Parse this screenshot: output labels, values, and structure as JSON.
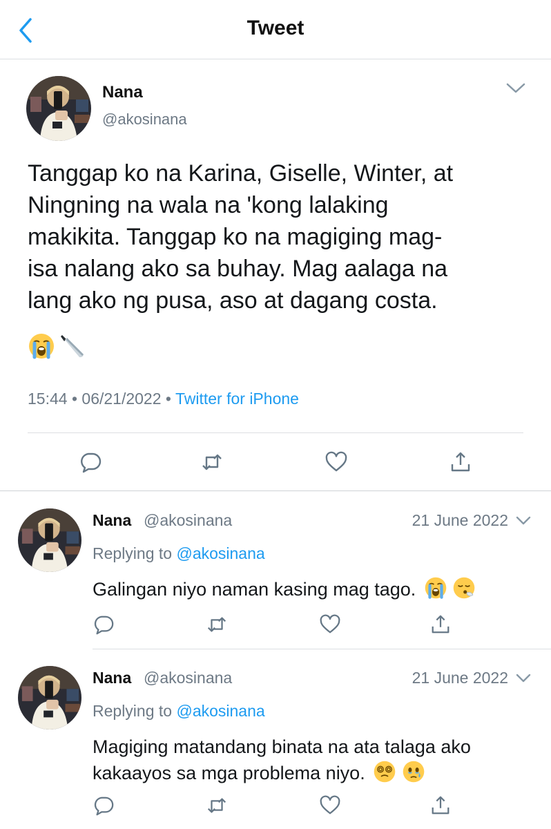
{
  "nav": {
    "title": "Tweet",
    "back_icon": "chevron-left-icon"
  },
  "colors": {
    "accent": "#1d9bf0",
    "muted": "#6d7985",
    "text": "#14171a",
    "divider": "#dcdfe2"
  },
  "tweet": {
    "name": "Nana",
    "handle": "@akosinana",
    "text": "Tanggap ko na Karina, Giselle, Winter, at\nNingning na wala na 'kong lalaking\nmakikita. Tanggap ko na magiging mag-\nisa nalang ako sa buhay. Mag aalaga na\nlang ako ng pusa, aso at dagang costa.",
    "emojis": [
      "loudly-crying-face-emoji",
      "knife-emoji"
    ],
    "time": "15:44",
    "date": "06/21/2022",
    "separator": "•",
    "source": "Twitter for iPhone"
  },
  "replies": [
    {
      "name": "Nana",
      "handle": "@akosinana",
      "date": "21 June 2022",
      "replying_label": "Replying to",
      "replying_to": "@akosinana",
      "text": "Galingan niyo naman kasing mag tago.",
      "emojis": [
        "loudly-crying-face-emoji",
        "face-exhaling-emoji"
      ]
    },
    {
      "name": "Nana",
      "handle": "@akosinana",
      "date": "21 June 2022",
      "replying_label": "Replying to",
      "replying_to": "@akosinana",
      "text": "Magiging matandang binata na ata talaga ako kakaayos sa mga problema niyo.",
      "emojis": [
        "face-with-spiral-eyes-emoji",
        "face-holding-back-tears-emoji"
      ]
    }
  ],
  "action_icons": [
    "reply-icon",
    "retweet-icon",
    "like-icon",
    "share-icon"
  ]
}
